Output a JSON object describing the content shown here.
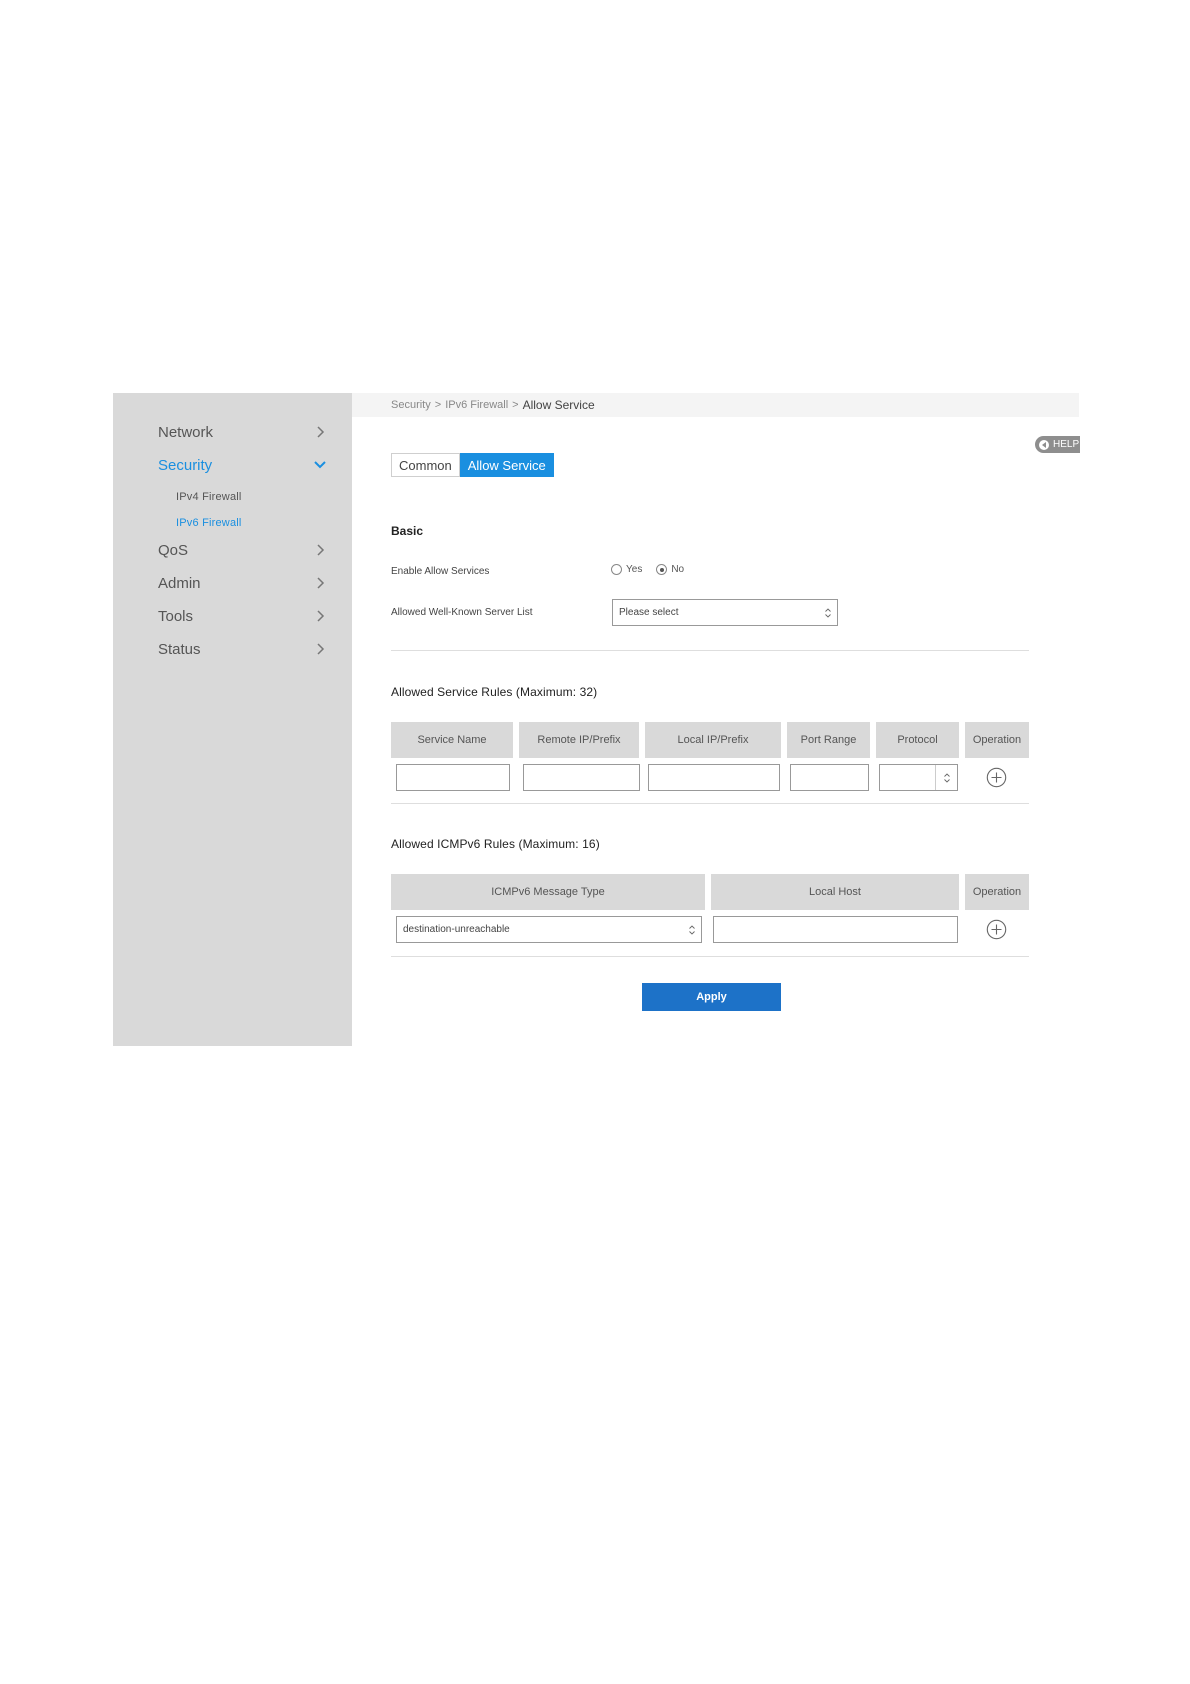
{
  "breadcrumb": {
    "items": [
      "Security",
      "IPv6 Firewall"
    ],
    "separator": ">",
    "current": "Allow Service"
  },
  "help": {
    "label": "HELP",
    "icon": "back-arrow-icon"
  },
  "sidebar": {
    "items": [
      {
        "label": "Network",
        "icon": "chevron-right-icon",
        "active": false
      },
      {
        "label": "Security",
        "icon": "chevron-down-icon",
        "active": true,
        "children": [
          {
            "label": "IPv4 Firewall",
            "active": false
          },
          {
            "label": "IPv6 Firewall",
            "active": true
          }
        ]
      },
      {
        "label": "QoS",
        "icon": "chevron-right-icon",
        "active": false
      },
      {
        "label": "Admin",
        "icon": "chevron-right-icon",
        "active": false
      },
      {
        "label": "Tools",
        "icon": "chevron-right-icon",
        "active": false
      },
      {
        "label": "Status",
        "icon": "chevron-right-icon",
        "active": false
      }
    ]
  },
  "tabs": [
    {
      "label": "Common",
      "active": false
    },
    {
      "label": "Allow Service",
      "active": true
    }
  ],
  "basic": {
    "title": "Basic",
    "enable_label": "Enable Allow Services",
    "enable_options": [
      {
        "label": "Yes",
        "checked": false
      },
      {
        "label": "No",
        "checked": true
      }
    ],
    "server_list_label": "Allowed Well-Known Server List",
    "server_list_value": "Please select"
  },
  "service_rules": {
    "title": "Allowed Service Rules (Maximum: 32)",
    "columns": [
      "Service Name",
      "Remote IP/Prefix",
      "Local IP/Prefix",
      "Port Range",
      "Protocol",
      "Operation"
    ],
    "row": {
      "service_name": "",
      "remote_ip": "",
      "local_ip": "",
      "port_range": "",
      "protocol": ""
    },
    "add_icon": "plus-circle-icon"
  },
  "icmp_rules": {
    "title": "Allowed ICMPv6 Rules (Maximum: 16)",
    "columns": [
      "ICMPv6 Message Type",
      "Local Host",
      "Operation"
    ],
    "row": {
      "message_type": "destination-unreachable",
      "local_host": ""
    },
    "add_icon": "plus-circle-icon"
  },
  "apply_label": "Apply",
  "colors": {
    "accent": "#1a8fe0",
    "apply": "#1d72c8",
    "sidebar_bg": "#d9d9d9",
    "header_bg": "#d9d9d9"
  }
}
